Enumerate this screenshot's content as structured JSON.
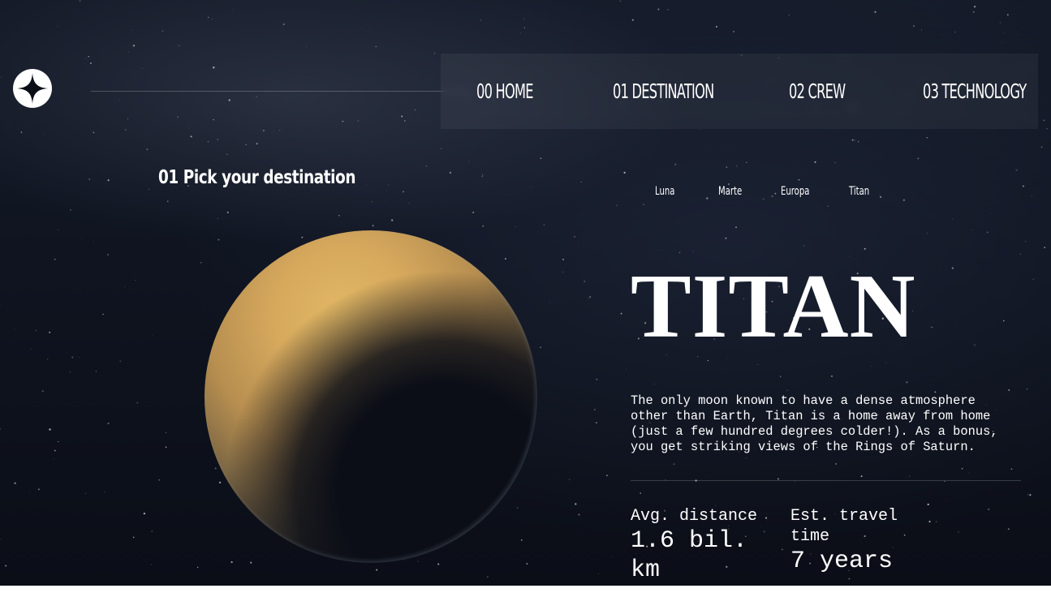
{
  "header": {
    "logo_icon": "star-icon",
    "nav": [
      {
        "num": "00",
        "label": "HOME"
      },
      {
        "num": "01",
        "label": "DESTINATION"
      },
      {
        "num": "02",
        "label": "CREW"
      },
      {
        "num": "03",
        "label": "TECHNOLOGY"
      }
    ]
  },
  "main": {
    "subheading": "01 Pick your destination",
    "tabs": [
      "Luna",
      "Marte",
      "Europa",
      "Titan"
    ],
    "active_tab": "Titan",
    "destination": {
      "name": "TITAN",
      "description": "The only moon known to have a dense atmosphere other than Earth, Titan is a home away from home (just a few hundred degrees colder!). As a bonus, you get striking views of the Rings of Saturn.",
      "distance_label": "Avg. distance",
      "distance_value": "1.6 bil. km",
      "travel_label": "Est. travel time",
      "travel_value": "7 years"
    }
  },
  "colors": {
    "background": "#0f1420",
    "text": "#ffffff",
    "planet": "#d6a95d"
  }
}
